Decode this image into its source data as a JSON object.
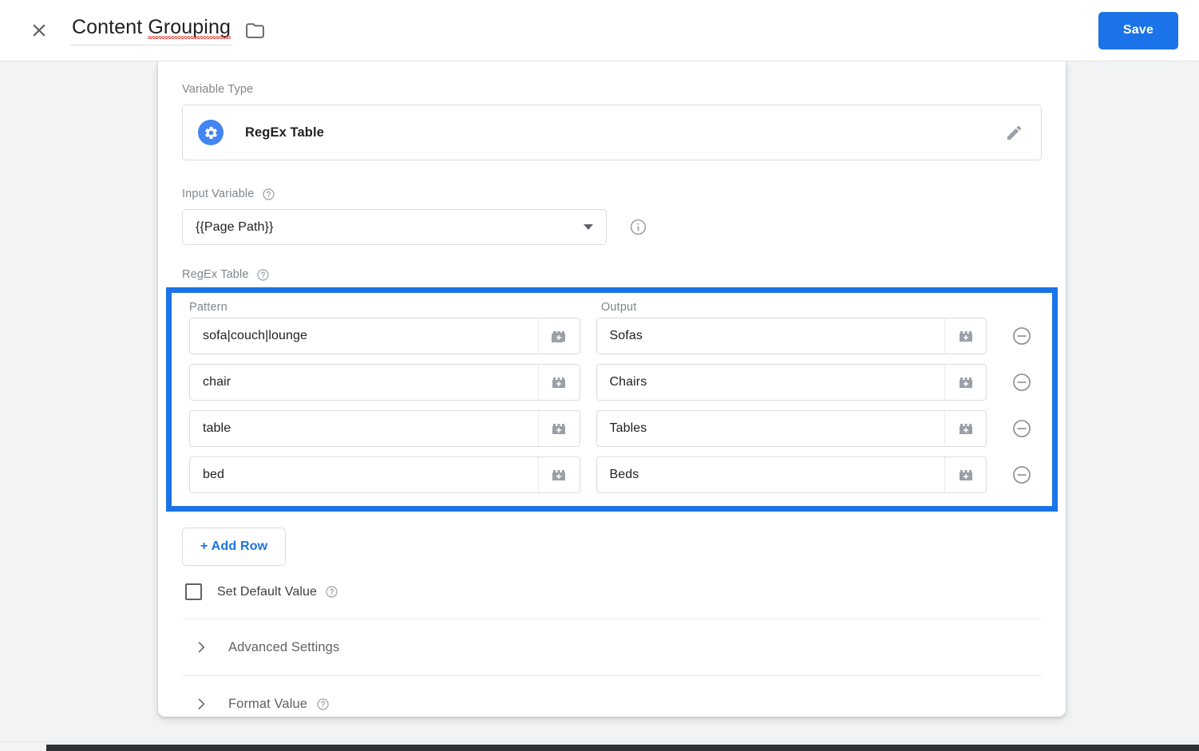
{
  "header": {
    "close_icon": "close-icon",
    "title": "Content Grouping",
    "title_word_plain": "Content ",
    "title_word_misspelled": "Grouping",
    "folder_icon": "folder-icon",
    "save_label": "Save",
    "accent_color": "#1a73e8"
  },
  "form": {
    "variable_type": {
      "label": "Variable Type",
      "name": "RegEx Table",
      "icon": "gear-icon",
      "icon_color": "#4285f4",
      "edit_icon": "pencil-icon"
    },
    "input_variable": {
      "label": "Input Variable",
      "help_icon": "help-circle-icon",
      "value": "{{Page Path}}",
      "caret_icon": "chevron-down-icon",
      "info_icon": "info-circle-icon"
    },
    "regex_table": {
      "label": "RegEx Table",
      "help_icon": "help-circle-icon",
      "highlight_color": "#1a73e8",
      "columns": [
        "Pattern",
        "Output"
      ],
      "rows": [
        {
          "pattern": "sofa|couch|lounge",
          "output": "Sofas"
        },
        {
          "pattern": "chair",
          "output": "Chairs"
        },
        {
          "pattern": "table",
          "output": "Tables"
        },
        {
          "pattern": "bed",
          "output": "Beds"
        }
      ],
      "brick_icon": "variable-picker-brick-icon",
      "remove_icon": "remove-circle-icon",
      "add_row_label": "+ Add Row"
    },
    "set_default_value": {
      "label": "Set Default Value",
      "checked": false,
      "help_icon": "help-circle-icon"
    },
    "sections": [
      {
        "title": "Advanced Settings",
        "chevron_icon": "chevron-right-icon",
        "has_help": false
      },
      {
        "title": "Format Value",
        "chevron_icon": "chevron-right-icon",
        "has_help": true
      }
    ]
  }
}
